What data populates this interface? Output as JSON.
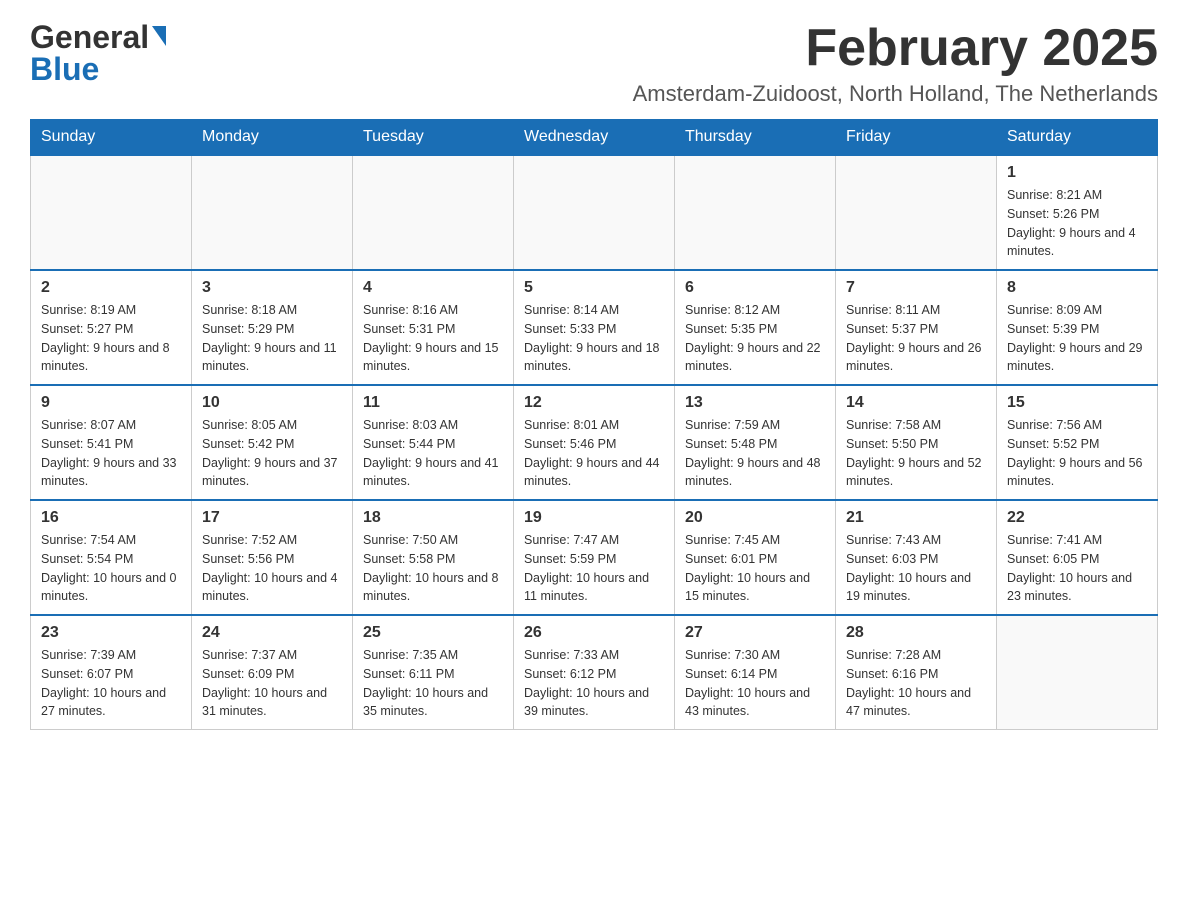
{
  "header": {
    "logo_text_general": "General",
    "logo_text_blue": "Blue",
    "month_title": "February 2025",
    "subtitle": "Amsterdam-Zuidoost, North Holland, The Netherlands"
  },
  "days_of_week": [
    "Sunday",
    "Monday",
    "Tuesday",
    "Wednesday",
    "Thursday",
    "Friday",
    "Saturday"
  ],
  "weeks": [
    {
      "days": [
        {
          "num": "",
          "info": ""
        },
        {
          "num": "",
          "info": ""
        },
        {
          "num": "",
          "info": ""
        },
        {
          "num": "",
          "info": ""
        },
        {
          "num": "",
          "info": ""
        },
        {
          "num": "",
          "info": ""
        },
        {
          "num": "1",
          "info": "Sunrise: 8:21 AM\nSunset: 5:26 PM\nDaylight: 9 hours and 4 minutes."
        }
      ]
    },
    {
      "days": [
        {
          "num": "2",
          "info": "Sunrise: 8:19 AM\nSunset: 5:27 PM\nDaylight: 9 hours and 8 minutes."
        },
        {
          "num": "3",
          "info": "Sunrise: 8:18 AM\nSunset: 5:29 PM\nDaylight: 9 hours and 11 minutes."
        },
        {
          "num": "4",
          "info": "Sunrise: 8:16 AM\nSunset: 5:31 PM\nDaylight: 9 hours and 15 minutes."
        },
        {
          "num": "5",
          "info": "Sunrise: 8:14 AM\nSunset: 5:33 PM\nDaylight: 9 hours and 18 minutes."
        },
        {
          "num": "6",
          "info": "Sunrise: 8:12 AM\nSunset: 5:35 PM\nDaylight: 9 hours and 22 minutes."
        },
        {
          "num": "7",
          "info": "Sunrise: 8:11 AM\nSunset: 5:37 PM\nDaylight: 9 hours and 26 minutes."
        },
        {
          "num": "8",
          "info": "Sunrise: 8:09 AM\nSunset: 5:39 PM\nDaylight: 9 hours and 29 minutes."
        }
      ]
    },
    {
      "days": [
        {
          "num": "9",
          "info": "Sunrise: 8:07 AM\nSunset: 5:41 PM\nDaylight: 9 hours and 33 minutes."
        },
        {
          "num": "10",
          "info": "Sunrise: 8:05 AM\nSunset: 5:42 PM\nDaylight: 9 hours and 37 minutes."
        },
        {
          "num": "11",
          "info": "Sunrise: 8:03 AM\nSunset: 5:44 PM\nDaylight: 9 hours and 41 minutes."
        },
        {
          "num": "12",
          "info": "Sunrise: 8:01 AM\nSunset: 5:46 PM\nDaylight: 9 hours and 44 minutes."
        },
        {
          "num": "13",
          "info": "Sunrise: 7:59 AM\nSunset: 5:48 PM\nDaylight: 9 hours and 48 minutes."
        },
        {
          "num": "14",
          "info": "Sunrise: 7:58 AM\nSunset: 5:50 PM\nDaylight: 9 hours and 52 minutes."
        },
        {
          "num": "15",
          "info": "Sunrise: 7:56 AM\nSunset: 5:52 PM\nDaylight: 9 hours and 56 minutes."
        }
      ]
    },
    {
      "days": [
        {
          "num": "16",
          "info": "Sunrise: 7:54 AM\nSunset: 5:54 PM\nDaylight: 10 hours and 0 minutes."
        },
        {
          "num": "17",
          "info": "Sunrise: 7:52 AM\nSunset: 5:56 PM\nDaylight: 10 hours and 4 minutes."
        },
        {
          "num": "18",
          "info": "Sunrise: 7:50 AM\nSunset: 5:58 PM\nDaylight: 10 hours and 8 minutes."
        },
        {
          "num": "19",
          "info": "Sunrise: 7:47 AM\nSunset: 5:59 PM\nDaylight: 10 hours and 11 minutes."
        },
        {
          "num": "20",
          "info": "Sunrise: 7:45 AM\nSunset: 6:01 PM\nDaylight: 10 hours and 15 minutes."
        },
        {
          "num": "21",
          "info": "Sunrise: 7:43 AM\nSunset: 6:03 PM\nDaylight: 10 hours and 19 minutes."
        },
        {
          "num": "22",
          "info": "Sunrise: 7:41 AM\nSunset: 6:05 PM\nDaylight: 10 hours and 23 minutes."
        }
      ]
    },
    {
      "days": [
        {
          "num": "23",
          "info": "Sunrise: 7:39 AM\nSunset: 6:07 PM\nDaylight: 10 hours and 27 minutes."
        },
        {
          "num": "24",
          "info": "Sunrise: 7:37 AM\nSunset: 6:09 PM\nDaylight: 10 hours and 31 minutes."
        },
        {
          "num": "25",
          "info": "Sunrise: 7:35 AM\nSunset: 6:11 PM\nDaylight: 10 hours and 35 minutes."
        },
        {
          "num": "26",
          "info": "Sunrise: 7:33 AM\nSunset: 6:12 PM\nDaylight: 10 hours and 39 minutes."
        },
        {
          "num": "27",
          "info": "Sunrise: 7:30 AM\nSunset: 6:14 PM\nDaylight: 10 hours and 43 minutes."
        },
        {
          "num": "28",
          "info": "Sunrise: 7:28 AM\nSunset: 6:16 PM\nDaylight: 10 hours and 47 minutes."
        },
        {
          "num": "",
          "info": ""
        }
      ]
    }
  ]
}
